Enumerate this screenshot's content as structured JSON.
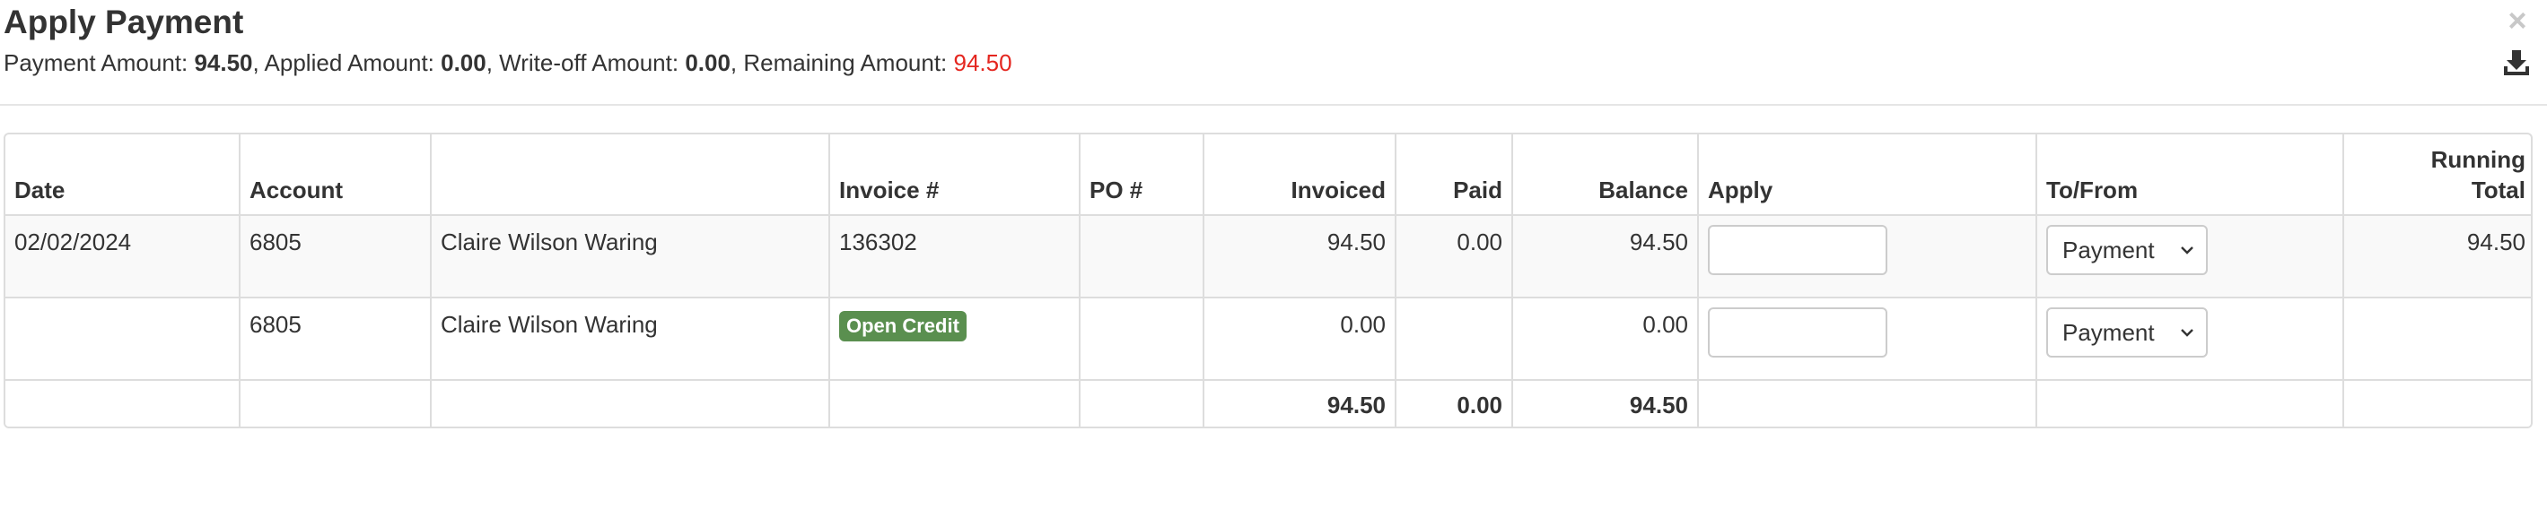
{
  "modal": {
    "title": "Apply Payment",
    "summary": {
      "payment_label": "Payment Amount: ",
      "payment_value": "94.50",
      "applied_label": ", Applied Amount: ",
      "applied_value": "0.00",
      "writeoff_label": ", Write-off Amount: ",
      "writeoff_value": "0.00",
      "remaining_label": ", Remaining Amount: ",
      "remaining_value": "94.50"
    },
    "close_glyph": "×",
    "icons": {
      "close": "close-icon",
      "export": "download-icon"
    }
  },
  "table": {
    "headers": {
      "date": "Date",
      "account": "Account",
      "name": "",
      "invoice": "Invoice #",
      "po": "PO #",
      "invoiced": "Invoiced",
      "paid": "Paid",
      "balance": "Balance",
      "apply": "Apply",
      "tofrom": "To/From",
      "running_total_line1": "Running",
      "running_total_line2": "Total"
    },
    "rows": [
      {
        "date": "02/02/2024",
        "account": "6805",
        "name": "Claire Wilson Waring",
        "invoice": "136302",
        "po": "",
        "invoiced": "94.50",
        "paid": "0.00",
        "balance": "94.50",
        "apply": "",
        "tofrom": "Payment",
        "running_total": "94.50"
      },
      {
        "date": "",
        "account": "6805",
        "name": "Claire Wilson Waring",
        "invoice_badge": "Open Credit",
        "po": "",
        "invoiced": "0.00",
        "paid": "",
        "balance": "0.00",
        "apply": "",
        "tofrom": "Payment",
        "running_total": ""
      }
    ],
    "totals": {
      "invoiced": "94.50",
      "paid": "0.00",
      "balance": "94.50"
    }
  },
  "colors": {
    "remaining_amount": "#e4261f",
    "badge_bg": "#5a8f4f",
    "border": "#dddddd",
    "row_stripe": "#f9f9f9"
  }
}
